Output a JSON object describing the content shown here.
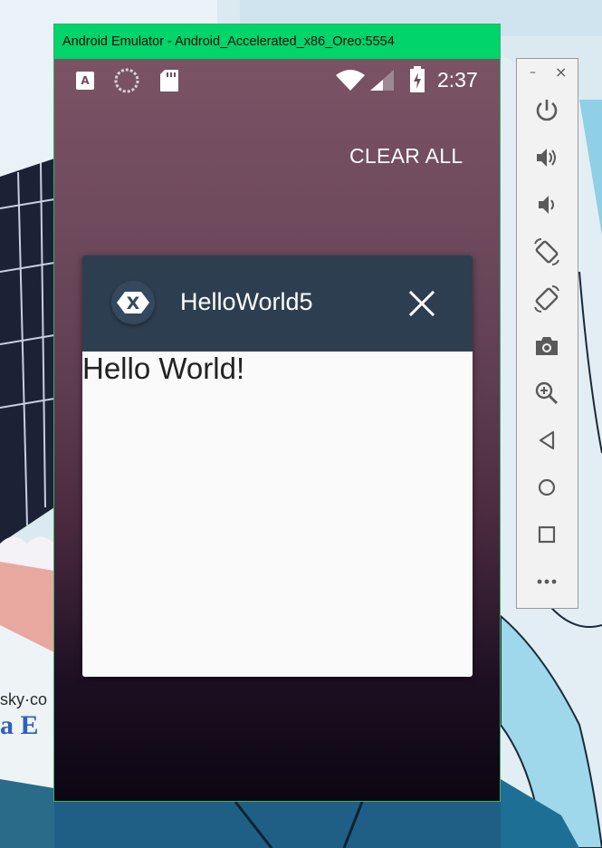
{
  "window": {
    "title": "Android Emulator - Android_Accelerated_x86_Oreo:5554"
  },
  "status_bar": {
    "time": "2:37",
    "icons": [
      "font-notification-icon",
      "sync-icon",
      "sd-card-icon",
      "wifi-icon",
      "cell-signal-icon",
      "battery-charging-icon"
    ]
  },
  "recents": {
    "clear_all_label": "CLEAR ALL",
    "card": {
      "app_icon_letter": "X",
      "app_name": "HelloWorld5",
      "content_text": "Hello World!",
      "header_color": "#2d3e50"
    }
  },
  "toolbar": {
    "minimize_label": "–",
    "close_label": "×",
    "buttons": [
      "power-icon",
      "volume-up-icon",
      "volume-down-icon",
      "rotate-left-icon",
      "rotate-right-icon",
      "camera-icon",
      "zoom-icon",
      "back-icon",
      "home-icon",
      "overview-icon",
      "more-icon"
    ]
  },
  "colors": {
    "titlebar": "#00d46a",
    "toolbar_icon": "#5a5a5a"
  }
}
